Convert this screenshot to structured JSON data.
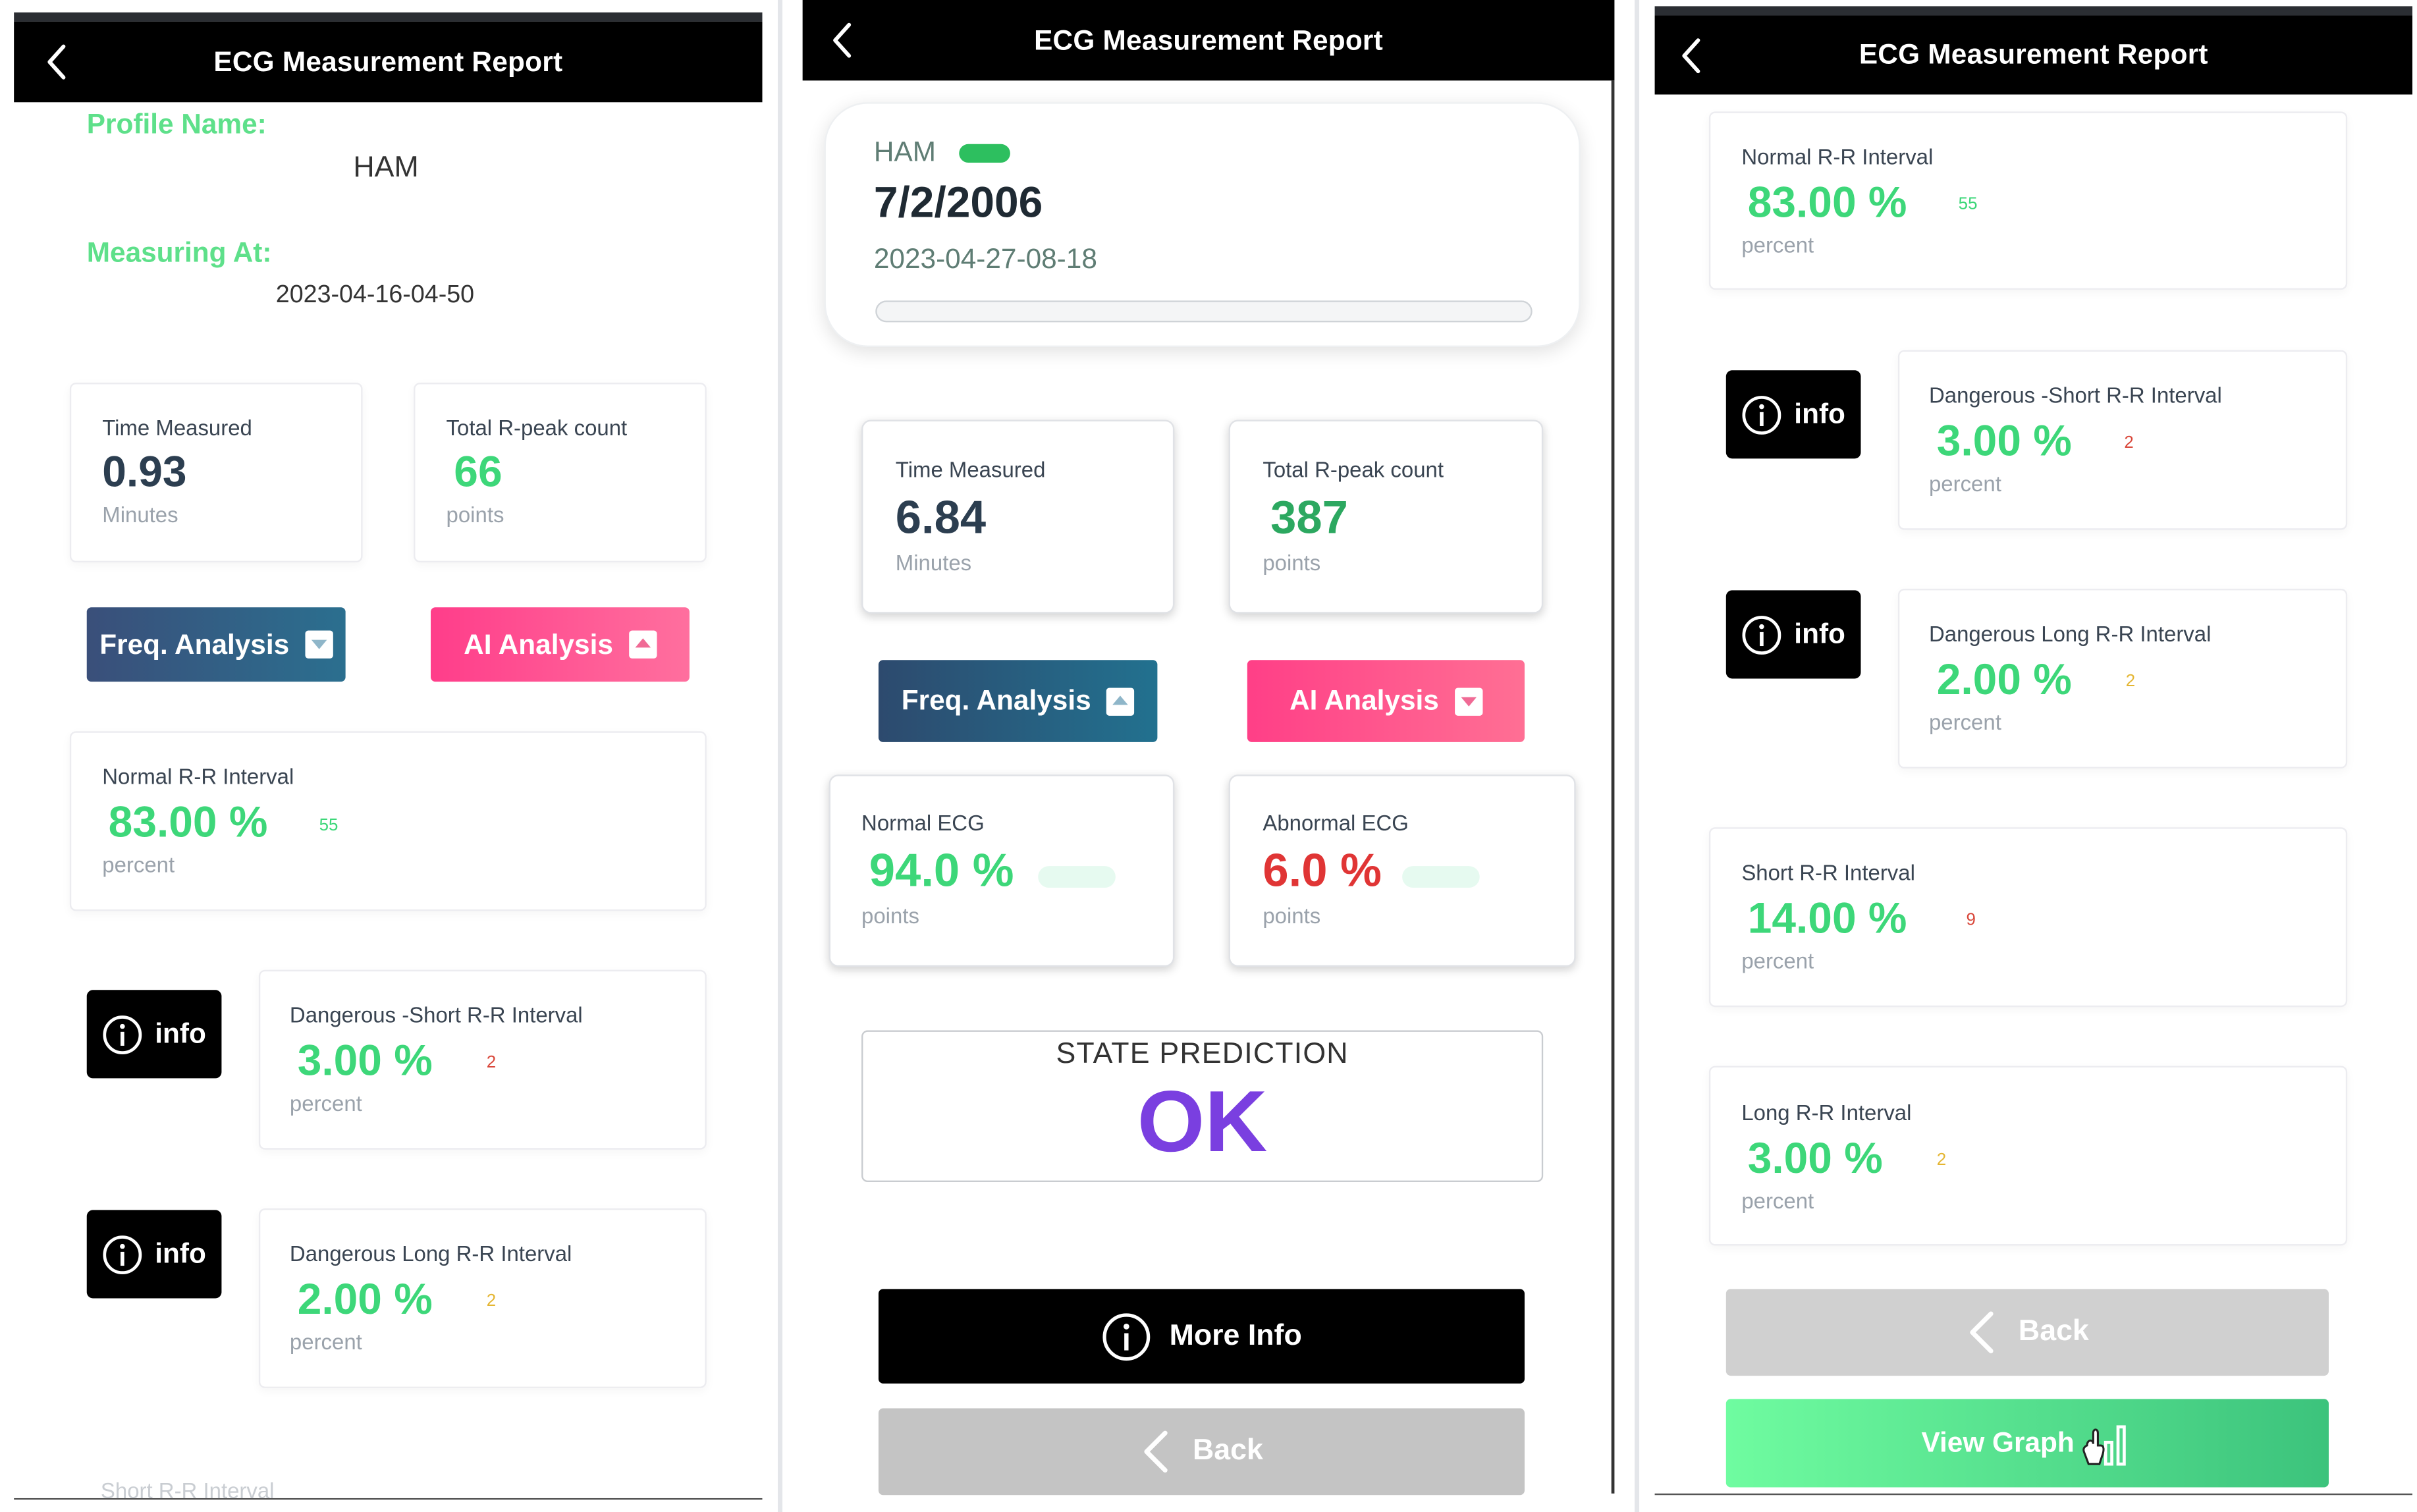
{
  "app_title": "ECG Measurement Report",
  "panel1": {
    "profile_label": "Profile Name:",
    "profile_value": "HAM",
    "measuring_label": "Measuring At:",
    "measuring_value": "2023-04-16-04-50",
    "time_measured": {
      "label": "Time Measured",
      "value": "0.93",
      "unit": "Minutes"
    },
    "rpeak": {
      "label": "Total R-peak count",
      "value": "66",
      "unit": "points"
    },
    "freq_button": "Freq. Analysis",
    "ai_button": "AI Analysis",
    "normal_rr": {
      "label": "Normal R-R Interval",
      "value": "83.00 %",
      "count": "55",
      "unit": "percent"
    },
    "info_label": "info",
    "danger_short": {
      "label": "Dangerous -Short R-R Interval",
      "value": "3.00 %",
      "count": "2",
      "unit": "percent"
    },
    "danger_long": {
      "label": "Dangerous Long R-R Interval",
      "value": "2.00 %",
      "count": "2",
      "unit": "percent"
    },
    "short_rr_faded": "Short R-R Interval"
  },
  "panel2": {
    "profile": "HAM",
    "date": "7/2/2006",
    "timestamp": "2023-04-27-08-18",
    "time_measured": {
      "label": "Time Measured",
      "value": "6.84",
      "unit": "Minutes"
    },
    "rpeak": {
      "label": "Total R-peak count",
      "value": "387",
      "unit": "points"
    },
    "freq_button": "Freq. Analysis",
    "ai_button": "AI Analysis",
    "normal_ecg": {
      "label": "Normal ECG",
      "value": "94.0 %",
      "unit": "points"
    },
    "abnormal_ecg": {
      "label": "Abnormal ECG",
      "value": "6.0 %",
      "unit": "points"
    },
    "state_label": "STATE PREDICTION",
    "state_value": "OK",
    "more_info_button": "More Info",
    "back_button": "Back"
  },
  "panel3": {
    "normal_rr": {
      "label": "Normal R-R Interval",
      "value": "83.00 %",
      "count": "55",
      "unit": "percent"
    },
    "info_label": "info",
    "danger_short": {
      "label": "Dangerous -Short R-R Interval",
      "value": "3.00 %",
      "count": "2",
      "unit": "percent"
    },
    "danger_long": {
      "label": "Dangerous Long R-R Interval",
      "value": "2.00 %",
      "count": "2",
      "unit": "percent"
    },
    "short_rr": {
      "label": "Short R-R Interval",
      "value": "14.00 %",
      "count": "9",
      "unit": "percent"
    },
    "long_rr": {
      "label": "Long R-R Interval",
      "value": "3.00 %",
      "count": "2",
      "unit": "percent"
    },
    "back_button": "Back",
    "view_graph_button": "View Graph"
  },
  "colors": {
    "green": "#3dd779",
    "label_green": "#5ee08a",
    "red": "#e03535",
    "purple": "#7a3fe0",
    "count_green": "#3dd779",
    "count_red": "#d9473a",
    "count_yellow": "#e4b531"
  },
  "icons": [
    "back-chevron-icon",
    "info-circle-icon",
    "dropdown-toggle-icon",
    "bar-chart-icon",
    "hand-cursor-icon"
  ]
}
